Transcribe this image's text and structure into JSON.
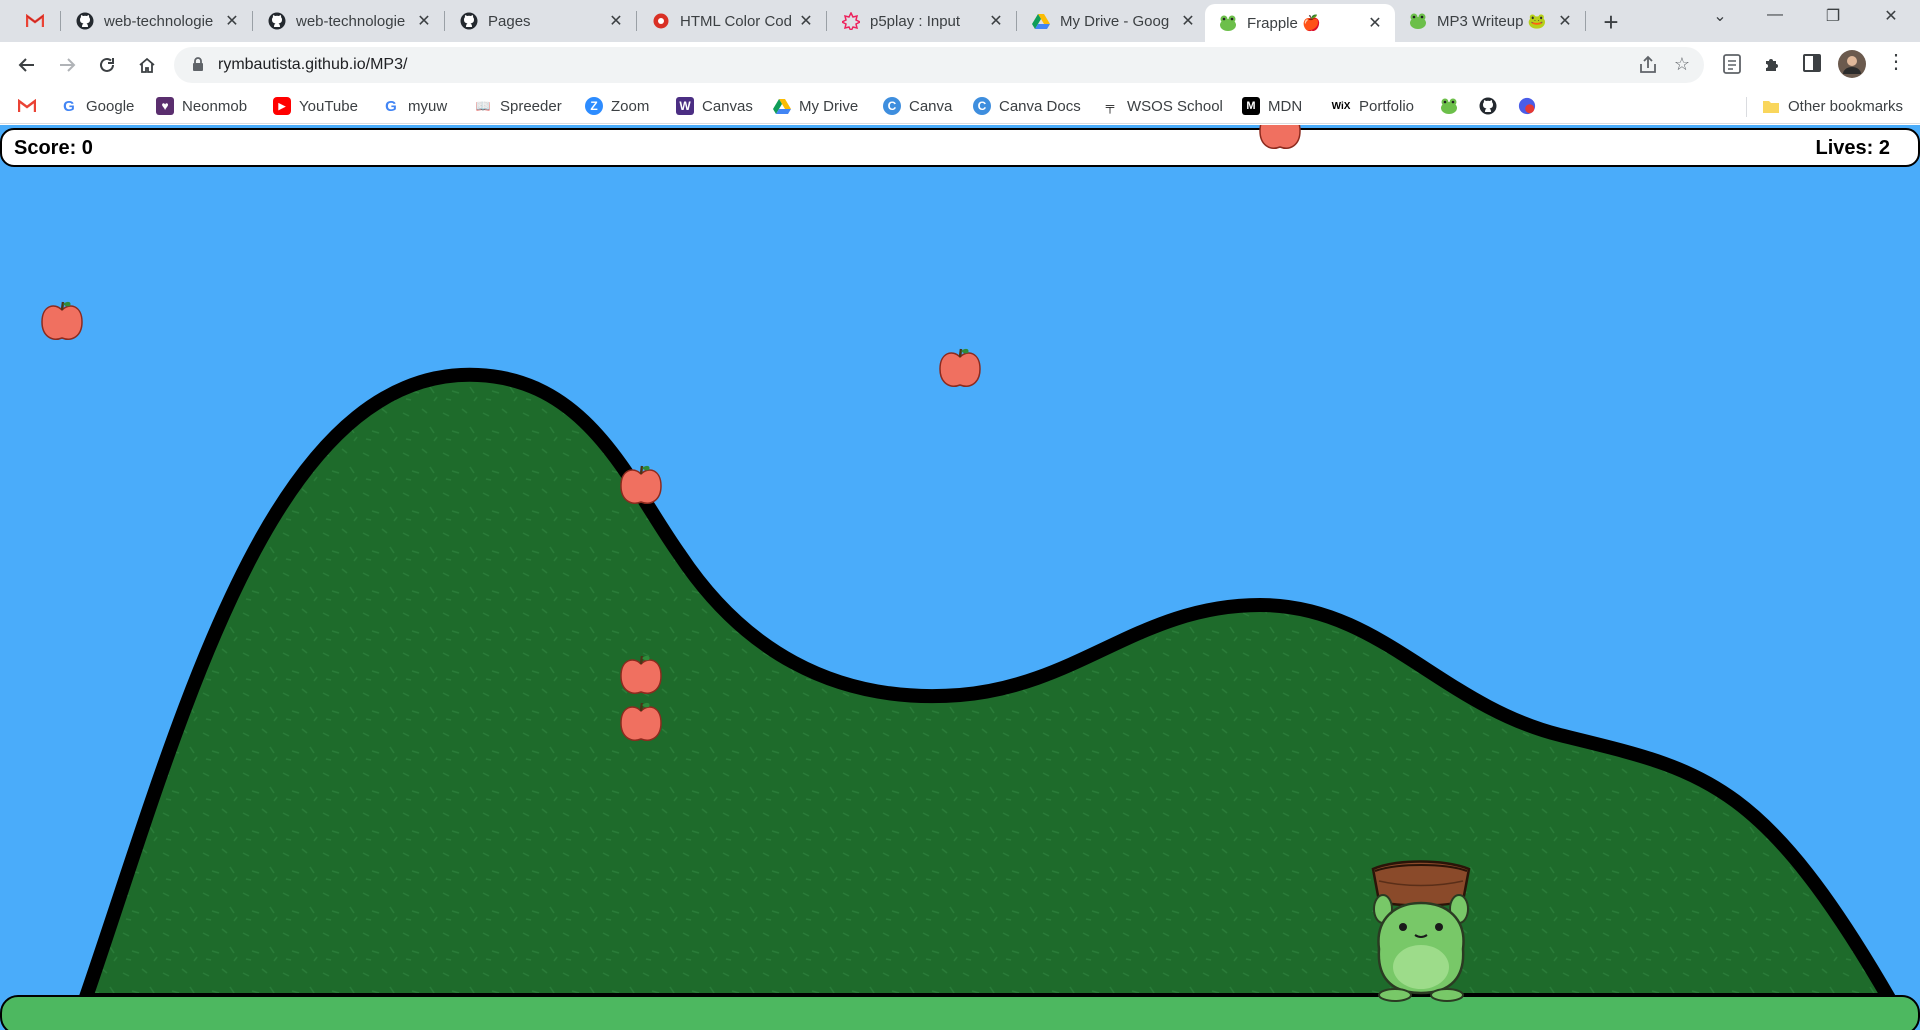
{
  "tabs": [
    {
      "title": "",
      "icon": "gmail-icon"
    },
    {
      "title": "web-technologie",
      "icon": "github-icon"
    },
    {
      "title": "web-technologie",
      "icon": "github-icon"
    },
    {
      "title": "Pages",
      "icon": "github-icon"
    },
    {
      "title": "HTML Color Cod",
      "icon": "color-picker-icon"
    },
    {
      "title": "p5play : Input",
      "icon": "p5play-icon"
    },
    {
      "title": "My Drive - Goog",
      "icon": "google-drive-icon"
    },
    {
      "title": "Frapple 🍎",
      "icon": "frog-icon",
      "active": true
    },
    {
      "title": "MP3 Writeup 🐸",
      "icon": "frog-icon"
    }
  ],
  "address_bar": {
    "url": "rymbautista.github.io/MP3/"
  },
  "bookmarks": [
    {
      "label": "",
      "icon": "gmail-icon"
    },
    {
      "label": "Google",
      "icon": "google-icon"
    },
    {
      "label": "Neonmob",
      "icon": "neonmob-icon"
    },
    {
      "label": "YouTube",
      "icon": "youtube-icon"
    },
    {
      "label": "myuw",
      "icon": "google-icon"
    },
    {
      "label": "Spreeder",
      "icon": "spreeder-icon"
    },
    {
      "label": "Zoom",
      "icon": "zoom-icon"
    },
    {
      "label": "Canvas",
      "icon": "canvas-icon"
    },
    {
      "label": "My Drive",
      "icon": "google-drive-icon"
    },
    {
      "label": "Canva",
      "icon": "canva-icon"
    },
    {
      "label": "Canva Docs",
      "icon": "canva-icon"
    },
    {
      "label": "WSOS School",
      "icon": "wsos-icon"
    },
    {
      "label": "MDN",
      "icon": "mdn-icon"
    },
    {
      "label": "Portfolio",
      "icon": "wix-icon"
    },
    {
      "label": "",
      "icon": "frog-icon"
    },
    {
      "label": "",
      "icon": "github-icon"
    },
    {
      "label": "",
      "icon": "notification-badge-icon"
    }
  ],
  "other_bookmarks": "Other bookmarks",
  "game": {
    "score": "Score: 0",
    "lives": "Lives: 2",
    "colors": {
      "sky": "#4aacfa",
      "hill": "#1e6b2b",
      "ground": "#4db860",
      "apple": "#f07060",
      "frog": "#78c868",
      "basket": "#8a4a2a"
    }
  }
}
